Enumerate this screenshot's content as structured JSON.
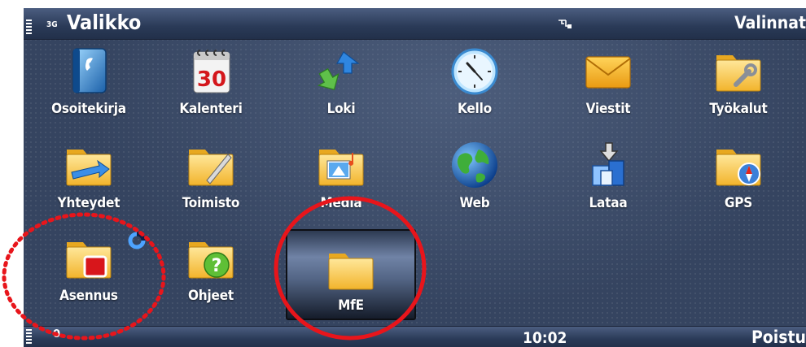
{
  "status": {
    "network": "3G",
    "app_title": "Valikko",
    "left_bottom_text": "0",
    "right_softkey": "Valinnat",
    "clock": "10:02",
    "right_bottom_softkey": "Poistu"
  },
  "menu": {
    "items": [
      {
        "label": "Osoitekirja",
        "icon": "contacts-icon",
        "selected": false
      },
      {
        "label": "Kalenteri",
        "icon": "calendar-icon",
        "calendar_day": "30",
        "selected": false
      },
      {
        "label": "Loki",
        "icon": "log-arrows-icon",
        "selected": false
      },
      {
        "label": "Kello",
        "icon": "clock-icon",
        "selected": false
      },
      {
        "label": "Viestit",
        "icon": "envelope-icon",
        "selected": false
      },
      {
        "label": "Työkalut",
        "icon": "tools-folder-icon",
        "selected": false
      },
      {
        "label": "Yhteydet",
        "icon": "connectivity-folder-icon",
        "selected": false
      },
      {
        "label": "Toimisto",
        "icon": "office-folder-icon",
        "selected": false
      },
      {
        "label": "Media",
        "icon": "media-folder-icon",
        "selected": false
      },
      {
        "label": "Web",
        "icon": "globe-icon",
        "selected": false
      },
      {
        "label": "Lataa",
        "icon": "download-icon",
        "selected": false
      },
      {
        "label": "GPS",
        "icon": "gps-folder-icon",
        "selected": false
      },
      {
        "label": "Asennus",
        "icon": "installation-folder-icon",
        "selected": false
      },
      {
        "label": "Ohjeet",
        "icon": "help-folder-icon",
        "selected": false
      },
      {
        "label": "MfE",
        "icon": "folder-icon",
        "selected": true
      }
    ]
  },
  "annotations": {
    "dotted_circle_color": "#e8151b",
    "solid_circle_color": "#e8151b"
  }
}
